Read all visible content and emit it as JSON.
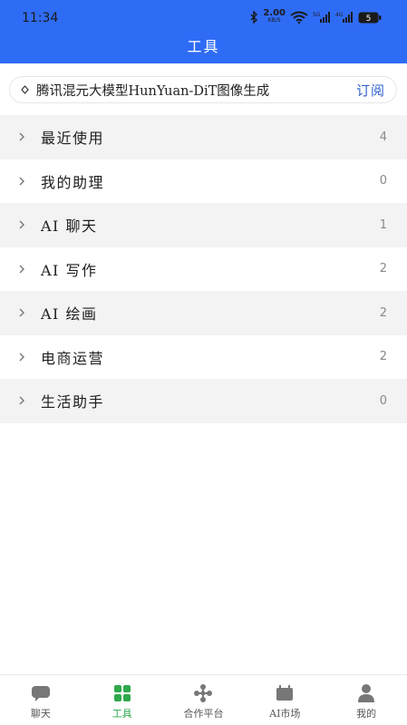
{
  "status_bar": {
    "time": "11:34",
    "net_speed": "2.00",
    "net_unit": "KB/S",
    "signal_1": "5G",
    "signal_2": "4G",
    "battery": "5"
  },
  "header": {
    "title": "工具"
  },
  "notice": {
    "text": "腾讯混元大模型HunYuan-DiT图像生成",
    "subscribe_label": "订阅"
  },
  "categories": [
    {
      "label": "最近使用",
      "count": "4"
    },
    {
      "label": "我的助理",
      "count": "0"
    },
    {
      "label": "AI 聊天",
      "count": "1"
    },
    {
      "label": "AI 写作",
      "count": "2"
    },
    {
      "label": "AI 绘画",
      "count": "2"
    },
    {
      "label": "电商运营",
      "count": "2"
    },
    {
      "label": "生活助手",
      "count": "0"
    }
  ],
  "tabbar": {
    "items": [
      {
        "label": "聊天",
        "icon": "chat-bubble-icon"
      },
      {
        "label": "工具",
        "icon": "grid-icon",
        "active": true
      },
      {
        "label": "合作平台",
        "icon": "network-icon"
      },
      {
        "label": "AI市场",
        "icon": "store-icon"
      },
      {
        "label": "我的",
        "icon": "person-icon"
      }
    ]
  },
  "colors": {
    "header": "#2f6cf5",
    "active_tab": "#2ea84a",
    "subscribe": "#2f5fd0"
  }
}
